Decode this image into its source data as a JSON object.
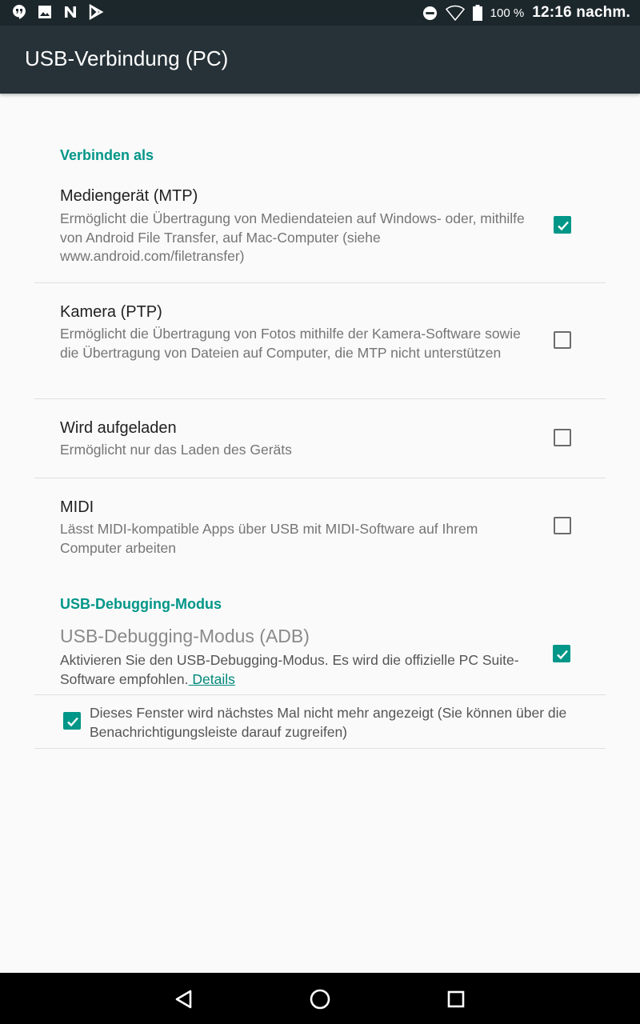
{
  "status_bar": {
    "battery_percent": "100 %",
    "time": "12:16 nachm."
  },
  "app_bar": {
    "title": "USB-Verbindung (PC)"
  },
  "sections": {
    "connect_as": "Verbinden als",
    "debugging": "USB-Debugging-Modus"
  },
  "options": [
    {
      "title": "Mediengerät (MTP)",
      "summary": "Ermöglicht die Übertragung von Mediendateien auf Windows- oder, mithilfe von Android File Transfer, auf Mac-Computer (siehe www.android.com/filetransfer)",
      "checked": true
    },
    {
      "title": "Kamera (PTP)",
      "summary": "Ermöglicht die Übertragung von Fotos mithilfe der Kamera-Software sowie die Übertragung von Dateien auf Computer, die MTP nicht unterstützen",
      "checked": false
    },
    {
      "title": "Wird aufgeladen",
      "summary": "Ermöglicht nur das Laden des Geräts",
      "checked": false
    },
    {
      "title": "MIDI",
      "summary": "Lässt MIDI-kompatible Apps über USB mit MIDI-Software auf Ihrem Computer arbeiten",
      "checked": false
    }
  ],
  "adb": {
    "title": "USB-Debugging-Modus (ADB)",
    "summary": "Aktivieren Sie den USB-Debugging-Modus. Es wird die offizielle PC Suite-Software empfohlen.",
    "link": " Details",
    "checked": true
  },
  "dont_show": {
    "text": "Dieses Fenster wird nächstes Mal nicht mehr angezeigt (Sie können über die Benachrichtigungsleiste darauf zugreifen)",
    "checked": true
  },
  "colors": {
    "accent": "#009688",
    "appbar": "#263238",
    "statusbar": "#1c272c"
  },
  "icons": [
    "hangouts-icon",
    "image-icon",
    "n-icon",
    "play-store-icon",
    "do-not-disturb-icon",
    "wifi-icon",
    "battery-icon",
    "back-icon",
    "home-icon",
    "recents-icon"
  ]
}
